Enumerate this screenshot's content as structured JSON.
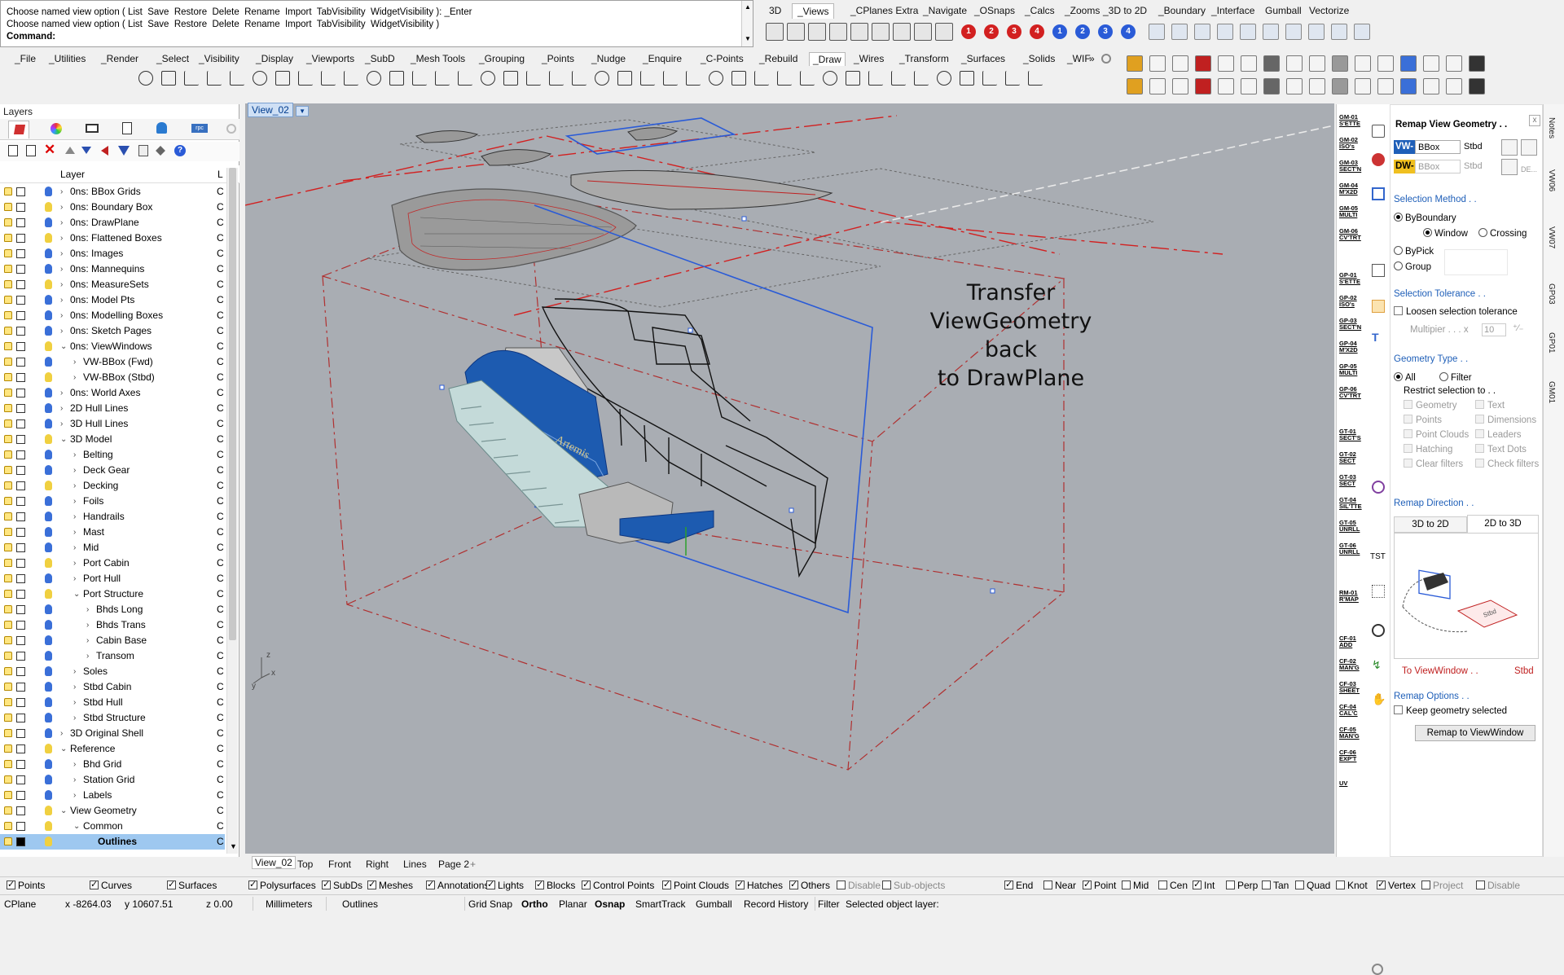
{
  "command": {
    "history": [
      "Choose named view option ( List  Save  Restore  Delete  Rename  Import  TabVisibility  WidgetVisibility ): _Enter",
      "Choose named view option ( List  Save  Restore  Delete  Rename  Import  TabVisibility  WidgetVisibility )"
    ],
    "prompt_label": "Command:",
    "prompt_value": ""
  },
  "top_tabs": [
    "3D",
    "_Views",
    "_CPlanes Extra",
    "_Navigate",
    "_OSnaps",
    "_Calcs",
    "_Zooms",
    "_3D to 2D",
    "_Boundary",
    "_Interface",
    "Gumball",
    "Vectorize"
  ],
  "top_tabs_active": "_Views",
  "main_tabs": [
    "_File",
    "_Utilities",
    "_Render",
    "_Select",
    "_Visibility",
    "_Display",
    "_Viewports",
    "_SubD",
    "_Mesh Tools",
    "_Grouping",
    "_Points",
    "_Nudge",
    "_Enquire",
    "_C-Points",
    "_Rebuild",
    "_Draw",
    "_Wires",
    "_Transform",
    "_Surfaces",
    "_Solids",
    "_WIF"
  ],
  "main_tabs_active": "_Draw",
  "overflow_marker": "»",
  "view_numbers": [
    "1",
    "2",
    "3",
    "4",
    "1",
    "2",
    "3",
    "4"
  ],
  "layers": {
    "panel_title": "Layers",
    "header_layer": "Layer",
    "header_col": "L",
    "rows": [
      {
        "name": "0ns: BBox Grids",
        "indent": 0,
        "expand": ">",
        "bulb": "#3a6fd8"
      },
      {
        "name": "0ns: Boundary Box",
        "indent": 0,
        "expand": ">",
        "bulb": "#f0d040"
      },
      {
        "name": "0ns: DrawPlane",
        "indent": 0,
        "expand": ">",
        "bulb": "#3a6fd8"
      },
      {
        "name": "0ns: Flattened Boxes",
        "indent": 0,
        "expand": ">",
        "bulb": "#f0d040"
      },
      {
        "name": "0ns: Images",
        "indent": 0,
        "expand": ">",
        "bulb": "#3a6fd8"
      },
      {
        "name": "0ns: Mannequins",
        "indent": 0,
        "expand": ">",
        "bulb": "#3a6fd8"
      },
      {
        "name": "0ns: MeasureSets",
        "indent": 0,
        "expand": ">",
        "bulb": "#f0d040"
      },
      {
        "name": "0ns: Model Pts",
        "indent": 0,
        "expand": ">",
        "bulb": "#3a6fd8"
      },
      {
        "name": "0ns: Modelling Boxes",
        "indent": 0,
        "expand": ">",
        "bulb": "#3a6fd8"
      },
      {
        "name": "0ns: Sketch Pages",
        "indent": 0,
        "expand": ">",
        "bulb": "#3a6fd8"
      },
      {
        "name": "0ns: ViewWindows",
        "indent": 0,
        "expand": "v",
        "bulb": "#f0d040"
      },
      {
        "name": "VW-BBox (Fwd)",
        "indent": 1,
        "expand": ">",
        "bulb": "#3a6fd8"
      },
      {
        "name": "VW-BBox (Stbd)",
        "indent": 1,
        "expand": ">",
        "bulb": "#f0d040"
      },
      {
        "name": "0ns: World Axes",
        "indent": 0,
        "expand": ">",
        "bulb": "#3a6fd8"
      },
      {
        "name": "2D Hull Lines",
        "indent": 0,
        "expand": ">",
        "bulb": "#3a6fd8"
      },
      {
        "name": "3D Hull Lines",
        "indent": 0,
        "expand": ">",
        "bulb": "#3a6fd8"
      },
      {
        "name": "3D Model",
        "indent": 0,
        "expand": "v",
        "bulb": "#f0d040"
      },
      {
        "name": "Belting",
        "indent": 1,
        "expand": ">",
        "bulb": "#3a6fd8"
      },
      {
        "name": "Deck Gear",
        "indent": 1,
        "expand": ">",
        "bulb": "#3a6fd8"
      },
      {
        "name": "Decking",
        "indent": 1,
        "expand": ">",
        "bulb": "#f0d040"
      },
      {
        "name": "Foils",
        "indent": 1,
        "expand": ">",
        "bulb": "#3a6fd8"
      },
      {
        "name": "Handrails",
        "indent": 1,
        "expand": ">",
        "bulb": "#3a6fd8"
      },
      {
        "name": "Mast",
        "indent": 1,
        "expand": ">",
        "bulb": "#3a6fd8"
      },
      {
        "name": "Mid",
        "indent": 1,
        "expand": ">",
        "bulb": "#3a6fd8"
      },
      {
        "name": "Port Cabin",
        "indent": 1,
        "expand": ">",
        "bulb": "#f0d040"
      },
      {
        "name": "Port Hull",
        "indent": 1,
        "expand": ">",
        "bulb": "#3a6fd8"
      },
      {
        "name": "Port Structure",
        "indent": 1,
        "expand": "v",
        "bulb": "#f0d040"
      },
      {
        "name": "Bhds Long",
        "indent": 2,
        "expand": ">",
        "bulb": "#3a6fd8"
      },
      {
        "name": "Bhds Trans",
        "indent": 2,
        "expand": ">",
        "bulb": "#3a6fd8"
      },
      {
        "name": "Cabin Base",
        "indent": 2,
        "expand": ">",
        "bulb": "#3a6fd8"
      },
      {
        "name": "Transom",
        "indent": 2,
        "expand": ">",
        "bulb": "#3a6fd8"
      },
      {
        "name": "Soles",
        "indent": 1,
        "expand": ">",
        "bulb": "#3a6fd8"
      },
      {
        "name": "Stbd Cabin",
        "indent": 1,
        "expand": ">",
        "bulb": "#3a6fd8"
      },
      {
        "name": "Stbd Hull",
        "indent": 1,
        "expand": ">",
        "bulb": "#3a6fd8"
      },
      {
        "name": "Stbd Structure",
        "indent": 1,
        "expand": ">",
        "bulb": "#3a6fd8"
      },
      {
        "name": "3D Original Shell",
        "indent": 0,
        "expand": ">",
        "bulb": "#3a6fd8"
      },
      {
        "name": "Reference",
        "indent": 0,
        "expand": "v",
        "bulb": "#f0d040"
      },
      {
        "name": "Bhd Grid",
        "indent": 1,
        "expand": ">",
        "bulb": "#3a6fd8"
      },
      {
        "name": "Station Grid",
        "indent": 1,
        "expand": ">",
        "bulb": "#3a6fd8"
      },
      {
        "name": "Labels",
        "indent": 1,
        "expand": ">",
        "bulb": "#3a6fd8"
      },
      {
        "name": "View Geometry",
        "indent": 0,
        "expand": "v",
        "bulb": "#f0d040"
      },
      {
        "name": "Common",
        "indent": 1,
        "expand": "v",
        "bulb": "#f0d040"
      },
      {
        "name": "Outlines",
        "indent": 2,
        "expand": "",
        "bulb": "#f0d040",
        "selected": true
      }
    ],
    "col_value": "C"
  },
  "viewport": {
    "title": "View_02",
    "annotation_lines": [
      "Transfer",
      "ViewGeometry back",
      "to DrawPlane"
    ],
    "boat_name": "Artemis",
    "axis_z": "z",
    "axis_y": "y",
    "axis_x": "x",
    "bottom_tabs": [
      "View_02",
      "Top",
      "Front",
      "Right",
      "Lines",
      "Page 2"
    ],
    "bottom_tab_active": "View_02",
    "add_tab": "+"
  },
  "osnap": {
    "filters": [
      {
        "label": "Points",
        "on": true
      },
      {
        "label": "Curves",
        "on": true
      },
      {
        "label": "Surfaces",
        "on": true
      },
      {
        "label": "Polysurfaces",
        "on": true
      },
      {
        "label": "SubDs",
        "on": true
      },
      {
        "label": "Meshes",
        "on": true
      },
      {
        "label": "Annotations",
        "on": true
      },
      {
        "label": "Lights",
        "on": true
      },
      {
        "label": "Blocks",
        "on": true
      },
      {
        "label": "Control Points",
        "on": true
      },
      {
        "label": "Point Clouds",
        "on": true
      },
      {
        "label": "Hatches",
        "on": true
      },
      {
        "label": "Others",
        "on": true
      },
      {
        "label": "Disable",
        "on": false,
        "dim": true
      },
      {
        "label": "Sub-objects",
        "on": false,
        "dim": true
      }
    ],
    "snaps": [
      {
        "label": "End",
        "on": true
      },
      {
        "label": "Near",
        "on": false
      },
      {
        "label": "Point",
        "on": true
      },
      {
        "label": "Mid",
        "on": false
      },
      {
        "label": "Cen",
        "on": false
      },
      {
        "label": "Int",
        "on": true
      },
      {
        "label": "Perp",
        "on": false
      },
      {
        "label": "Tan",
        "on": false
      },
      {
        "label": "Quad",
        "on": false
      },
      {
        "label": "Knot",
        "on": false
      },
      {
        "label": "Vertex",
        "on": true
      },
      {
        "label": "Project",
        "on": false,
        "dim": true
      },
      {
        "label": "Disable",
        "on": false,
        "dim": true
      }
    ]
  },
  "status": {
    "cplane": "CPlane",
    "x": "x -8264.03",
    "y": "y 10607.51",
    "z": "z 0.00",
    "units": "Millimeters",
    "layer": "Outlines",
    "toggles": [
      "Grid Snap",
      "Ortho",
      "Planar",
      "Osnap",
      "SmartTrack",
      "Gumball",
      "Record History",
      "Filter"
    ],
    "bold_toggles": [
      "Ortho",
      "Osnap"
    ],
    "message": "Selected object layer:"
  },
  "gm_strip": [
    {
      "code": "GM-01",
      "sub": "S'ETTE"
    },
    {
      "code": "GM-02",
      "sub": "ISO's"
    },
    {
      "code": "GM-03",
      "sub": "SECT'N"
    },
    {
      "code": "GM-04",
      "sub": "M'X2D"
    },
    {
      "code": "GM-05",
      "sub": "MULTI"
    },
    {
      "code": "GM-06",
      "sub": "CV'TRT"
    },
    {
      "code": "GP-01",
      "sub": "S'ETTE"
    },
    {
      "code": "GP-02",
      "sub": "ISO's"
    },
    {
      "code": "GP-03",
      "sub": "SECT'N"
    },
    {
      "code": "GP-04",
      "sub": "M'X2D"
    },
    {
      "code": "GP-05",
      "sub": "MULTI"
    },
    {
      "code": "GP-06",
      "sub": "CV'TRT"
    },
    {
      "code": "GT-01",
      "sub": "SECT'S"
    },
    {
      "code": "GT-02",
      "sub": "SECT"
    },
    {
      "code": "GT-03",
      "sub": "SECT"
    },
    {
      "code": "GT-04",
      "sub": "SIL'TTE"
    },
    {
      "code": "GT-05",
      "sub": "UNRLL"
    },
    {
      "code": "GT-06",
      "sub": "UNRLL"
    },
    {
      "code": "RM-01",
      "sub": "R'MAP"
    },
    {
      "code": "CF-01",
      "sub": "ADD"
    },
    {
      "code": "CF-02",
      "sub": "MAN'G"
    },
    {
      "code": "CF-03",
      "sub": "SHEET"
    },
    {
      "code": "CF-04",
      "sub": "CAL'C"
    },
    {
      "code": "CF-05",
      "sub": "MAN'G"
    },
    {
      "code": "CF-06",
      "sub": "EXP'T"
    },
    {
      "code": "UV",
      "sub": ""
    }
  ],
  "remap": {
    "title": "Remap View Geometry . .",
    "close": "x",
    "vw_label": "VW-",
    "vw_value": "BBox",
    "vw_side": "Stbd",
    "dw_label": "DW-",
    "dw_value": "BBox",
    "dw_side": "Stbd",
    "de_label": "DE...",
    "selection_method": "Selection Method . .",
    "by_boundary": "ByBoundary",
    "window": "Window",
    "crossing": "Crossing",
    "by_pick": "ByPick",
    "group": "Group",
    "tolerance": "Selection Tolerance . .",
    "loosen": "Loosen selection tolerance",
    "multiplier": "Multipier . . . x",
    "multiplier_value": "10",
    "geometry_type": "Geometry Type . .",
    "all": "All",
    "filter": "Filter",
    "restrict": "Restrict selection to . .",
    "types_left": [
      "Geometry",
      "Points",
      "Point Clouds",
      "Hatching",
      "Clear filters"
    ],
    "types_right": [
      "Text",
      "Dimensions",
      "Leaders",
      "Text Dots",
      "Check filters"
    ],
    "direction": "Remap Direction . .",
    "dir_tab1": "3D to 2D",
    "dir_tab2": "2D to 3D",
    "diagram_label": "Stbd",
    "to_viewwindow": "To ViewWindow . .",
    "to_side": "Stbd",
    "options": "Remap Options . .",
    "keep": "Keep geometry selected",
    "button": "Remap to ViewWindow"
  },
  "side_tabs": [
    "Notes",
    "VW06",
    "VW07",
    "GP03",
    "GP01",
    "GM01"
  ],
  "colors": {
    "viewport_bg": "#a9adb3",
    "hull_blue": "#1d5bb0",
    "frame_blue": "#2a5bd7",
    "axis_red": "#d22020",
    "selection_blue": "#9ec8f0"
  }
}
